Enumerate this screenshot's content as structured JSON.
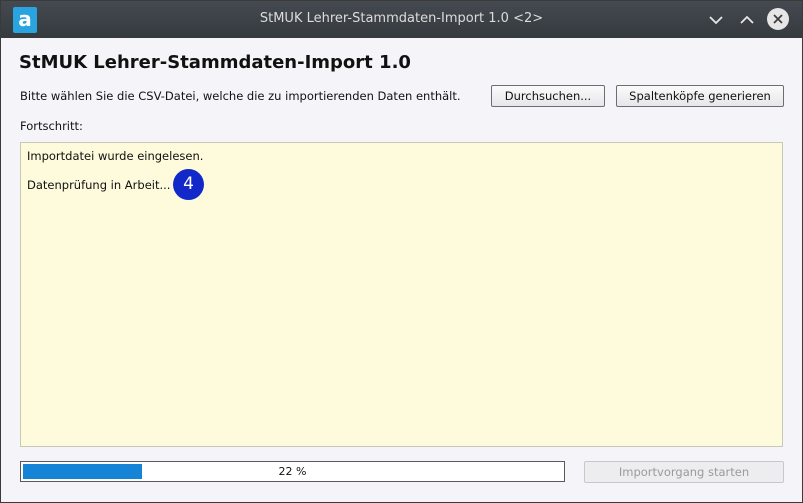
{
  "window": {
    "title": "StMUK Lehrer-Stammdaten-Import 1.0 <2>",
    "app_icon_letter": "a"
  },
  "main": {
    "heading": "StMUK Lehrer-Stammdaten-Import 1.0",
    "instruction": "Bitte wählen Sie die CSV-Datei, welche die zu importierenden Daten enthält.",
    "browse_label": "Durchsuchen...",
    "generate_headers_label": "Spaltenköpfe generieren",
    "progress_label": "Fortschritt:",
    "log_lines": [
      "Importdatei wurde eingelesen.",
      "Datenprüfung in Arbeit..."
    ],
    "step_badge": "4",
    "progress": {
      "percent": 22,
      "text": "22 %"
    },
    "start_import_label": "Importvorgang starten"
  },
  "colors": {
    "progress_fill": "#1583d6",
    "log_background": "#fdfbdc",
    "step_badge": "#1328c8",
    "titlebar": "#3d4247"
  },
  "icons": {
    "app": "app-logo-icon",
    "minimize": "chevron-down-icon",
    "maximize": "chevron-up-icon",
    "close": "close-icon"
  }
}
